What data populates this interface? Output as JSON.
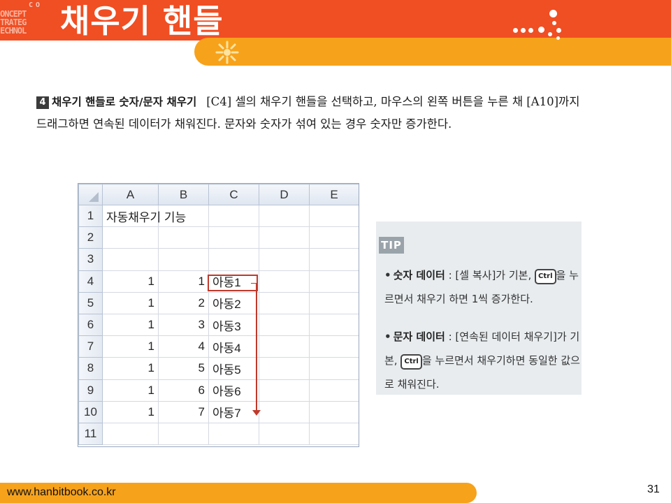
{
  "header": {
    "title": "채우기 핸들",
    "logo_lines": [
      "C O",
      "ONCEPT",
      "TRATEG",
      "ECHNOL"
    ],
    "colors": {
      "primary": "#f04e23",
      "secondary": "#f7a21b"
    }
  },
  "instruction": {
    "step_number": "4",
    "heading": "채우기 핸들로 숫자/문자 채우기",
    "body": "[C4] 셀의 채우기 핸들을 선택하고, 마우스의 왼쪽 버튼을 누른 채 [A10]까지 드래그하면 연속된 데이터가 채워진다. 문자와 숫자가 섞여 있는 경우 숫자만 증가한다."
  },
  "sheet": {
    "columns": [
      "A",
      "B",
      "C",
      "D",
      "E"
    ],
    "rows": [
      {
        "num": "1",
        "cells": [
          "자동채우기 기능",
          "",
          "",
          "",
          ""
        ]
      },
      {
        "num": "2",
        "cells": [
          "",
          "",
          "",
          "",
          ""
        ]
      },
      {
        "num": "3",
        "cells": [
          "",
          "",
          "",
          "",
          ""
        ]
      },
      {
        "num": "4",
        "cells": [
          "1",
          "1",
          "아동1",
          "",
          ""
        ]
      },
      {
        "num": "5",
        "cells": [
          "1",
          "2",
          "아동2",
          "",
          ""
        ]
      },
      {
        "num": "6",
        "cells": [
          "1",
          "3",
          "아동3",
          "",
          ""
        ]
      },
      {
        "num": "7",
        "cells": [
          "1",
          "4",
          "아동4",
          "",
          ""
        ]
      },
      {
        "num": "8",
        "cells": [
          "1",
          "5",
          "아동5",
          "",
          ""
        ]
      },
      {
        "num": "9",
        "cells": [
          "1",
          "6",
          "아동6",
          "",
          ""
        ]
      },
      {
        "num": "10",
        "cells": [
          "1",
          "7",
          "아동7",
          "",
          ""
        ]
      },
      {
        "num": "11",
        "cells": [
          "",
          "",
          "",
          "",
          ""
        ]
      }
    ],
    "selected_cell": "C4",
    "highlight_color": "#c0392b"
  },
  "tip": {
    "badge": "TIP",
    "items": [
      {
        "term": "숫자 데이터",
        "before_key": " : [셀 복사]가 기본,",
        "key": "Ctrl",
        "after_key": "을 누르면서 채우기 하면 1씩 증가한다."
      },
      {
        "term": "문자 데이터",
        "before_key": " : [연속된 데이터 채우기]가 기본,",
        "key": "Ctrl",
        "after_key": "을 누르면서 채우기하면 동일한 값으로 채워진다."
      }
    ]
  },
  "footer": {
    "url": "www.hanbitbook.co.kr",
    "page_number": "31"
  }
}
